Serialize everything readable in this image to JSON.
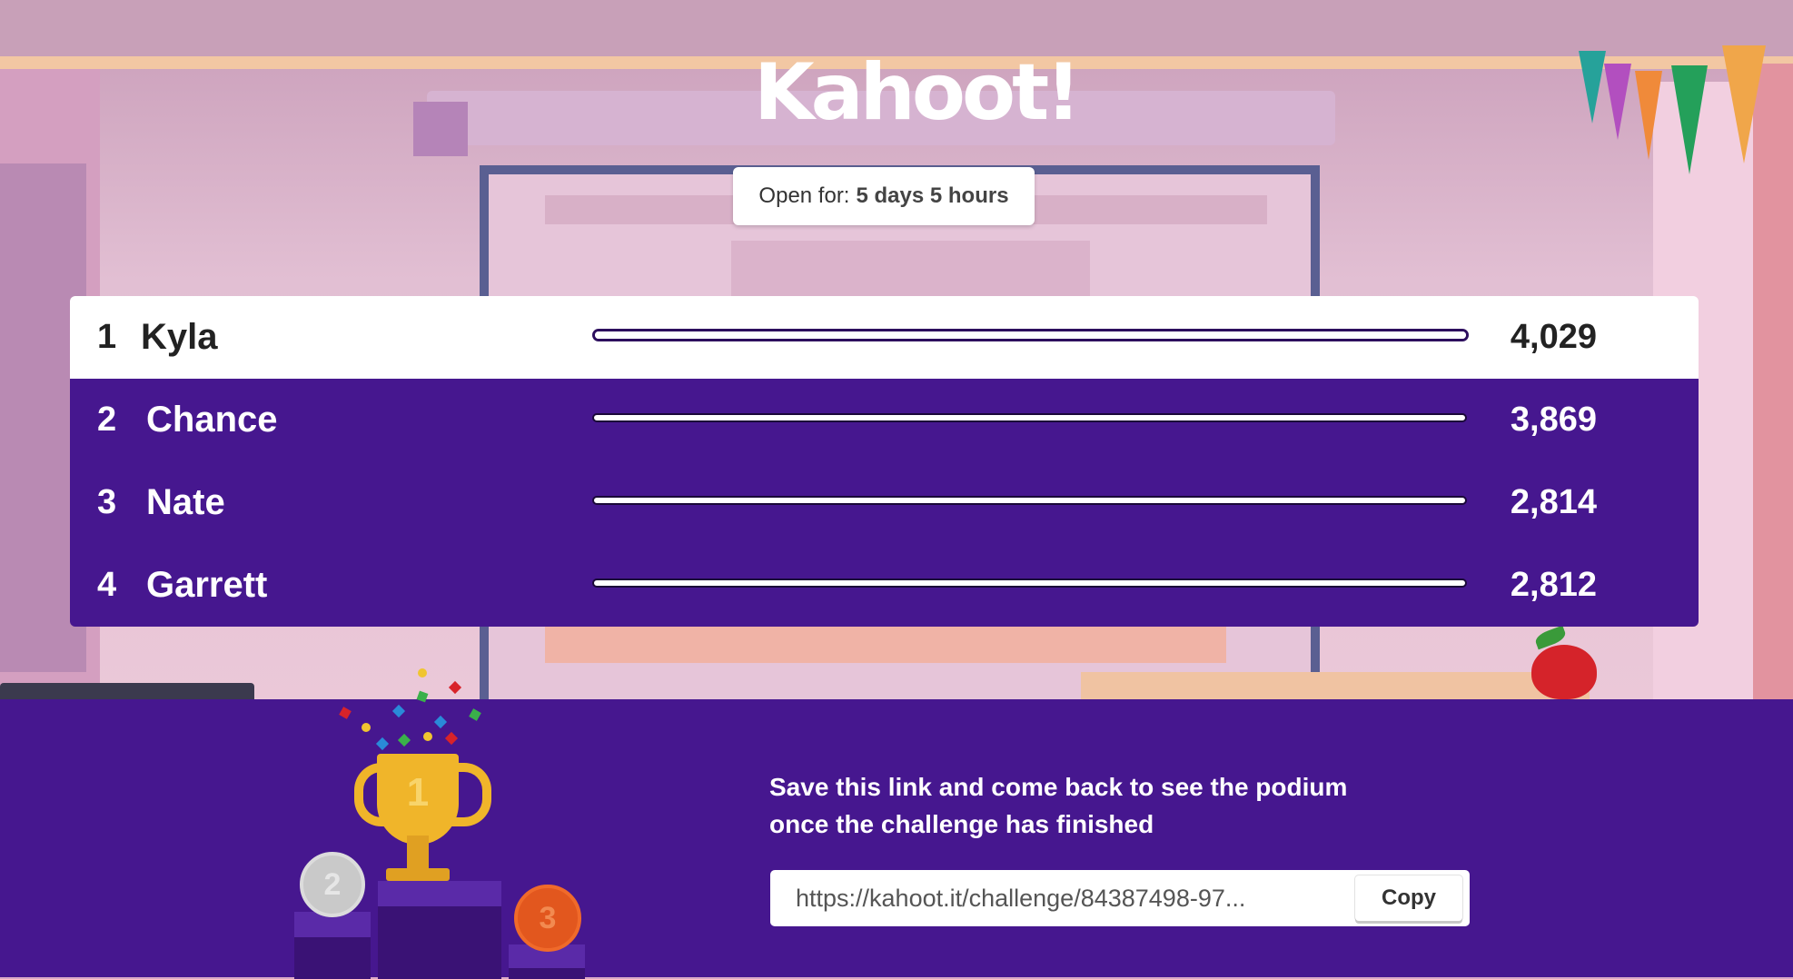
{
  "header": {
    "logo_text": "Kahoot!",
    "open_label": "Open for:",
    "open_value": "5 days 5 hours"
  },
  "leaderboard": [
    {
      "rank": "1",
      "name": "Kyla",
      "score": "4,029",
      "progress": 1.0
    },
    {
      "rank": "2",
      "name": "Chance",
      "score": "3,869",
      "progress": 1.0
    },
    {
      "rank": "3",
      "name": "Nate",
      "score": "2,814",
      "progress": 1.0
    },
    {
      "rank": "4",
      "name": "Garrett",
      "score": "2,812",
      "progress": 1.0
    }
  ],
  "podium": {
    "first": "1",
    "second": "2",
    "third": "3"
  },
  "share": {
    "message_line1": "Save this link and come back to see the podium",
    "message_line2": "once the challenge has finished",
    "link": "https://kahoot.it/challenge/84387498-97...",
    "copy_label": "Copy"
  },
  "colors": {
    "brand_purple": "#46178f",
    "gold": "#f0b52a",
    "silver": "#c9c9c9",
    "bronze": "#e2571e"
  }
}
